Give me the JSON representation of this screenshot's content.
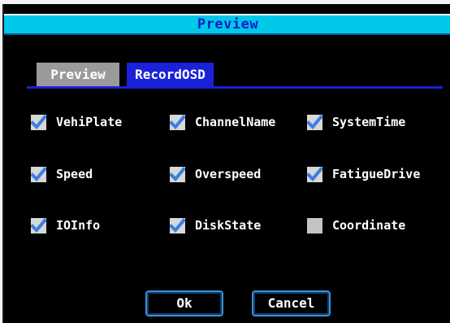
{
  "window": {
    "title": "Preview"
  },
  "tabs": [
    {
      "label": "Preview",
      "active": false
    },
    {
      "label": "RecordOSD",
      "active": true
    }
  ],
  "options": [
    {
      "label": "VehiPlate",
      "checked": true
    },
    {
      "label": "ChannelName",
      "checked": true
    },
    {
      "label": "SystemTime",
      "checked": true
    },
    {
      "label": "Speed",
      "checked": true
    },
    {
      "label": "Overspeed",
      "checked": true
    },
    {
      "label": "FatigueDrive",
      "checked": true
    },
    {
      "label": "IOInfo",
      "checked": true
    },
    {
      "label": "DiskState",
      "checked": true
    },
    {
      "label": "Coordinate",
      "checked": false
    }
  ],
  "buttons": {
    "ok_label": "Ok",
    "cancel_label": "Cancel"
  },
  "colors": {
    "title_bar": "#00c8e8",
    "title_text": "#1020c8",
    "active_tab": "#1a22d8",
    "inactive_tab": "#9a9a9a",
    "check_mark": "#3c7ee0",
    "background": "#000000"
  }
}
